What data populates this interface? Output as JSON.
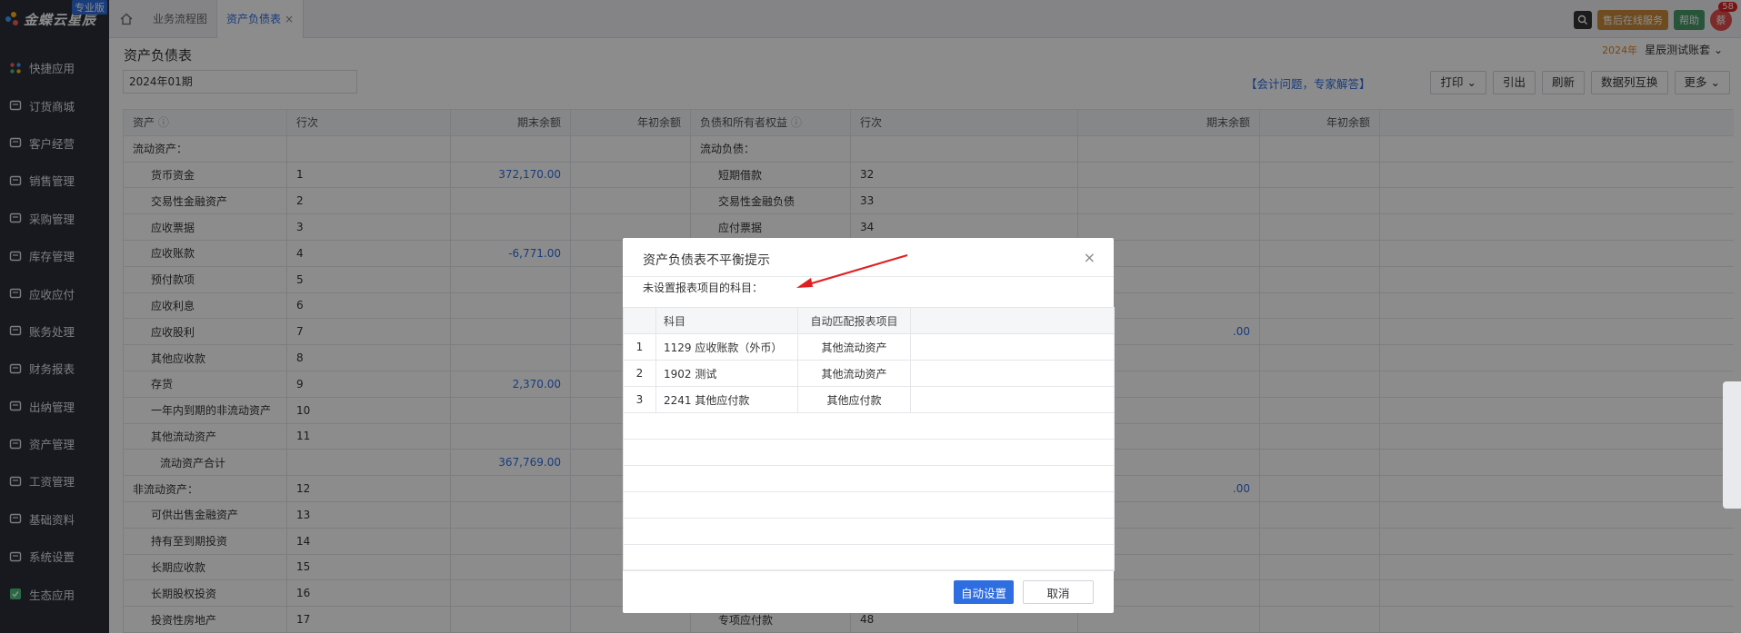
{
  "app": {
    "brand": "金蝶云星辰",
    "edition_badge": "专业版"
  },
  "sidebar": {
    "items": [
      {
        "label": "快捷应用",
        "icon": "grid-icon"
      },
      {
        "label": "订货商城",
        "icon": "shop-icon"
      },
      {
        "label": "客户经营",
        "icon": "user-icon"
      },
      {
        "label": "销售管理",
        "icon": "chart-icon"
      },
      {
        "label": "采购管理",
        "icon": "cart-icon"
      },
      {
        "label": "库存管理",
        "icon": "box-icon"
      },
      {
        "label": "应收应付",
        "icon": "money-icon"
      },
      {
        "label": "账务处理",
        "icon": "ledger-icon"
      },
      {
        "label": "财务报表",
        "icon": "report-icon"
      },
      {
        "label": "出纳管理",
        "icon": "cashier-icon"
      },
      {
        "label": "资产管理",
        "icon": "asset-icon"
      },
      {
        "label": "工资管理",
        "icon": "salary-icon"
      },
      {
        "label": "基础资料",
        "icon": "layers-icon"
      },
      {
        "label": "系统设置",
        "icon": "gear-icon"
      },
      {
        "label": "生态应用",
        "icon": "check-icon"
      }
    ]
  },
  "topbar": {
    "tabs": [
      {
        "label": "业务流程图"
      },
      {
        "label": "资产负债表",
        "close": "×"
      }
    ],
    "service_label": "售后在线服务",
    "help_label": "帮助",
    "avatar_text": "蔡",
    "notify_count": "58"
  },
  "page": {
    "title": "资产负债表",
    "period_value": "2024年01期",
    "meta_year": "2024年",
    "account_set": "星辰测试账套",
    "expert_link": "【会计问题，专家解答】",
    "toolbar": {
      "print": "打印",
      "export": "引出",
      "refresh": "刷新",
      "swap": "数据列互换",
      "more": "更多"
    }
  },
  "balance_sheet": {
    "headers": {
      "asset": "资产",
      "row": "行次",
      "end_bal": "期末余额",
      "begin_bal": "年初余额",
      "liab": "负债和所有者权益",
      "row2": "行次",
      "end_bal2": "期末余额",
      "begin_bal2": "年初余额"
    },
    "rows": [
      {
        "a": "流动资产：",
        "ar": "",
        "ae": "",
        "ab": "",
        "l": "流动负债：",
        "lr": "",
        "le": "",
        "lb": "",
        "ai": 0,
        "li": 0
      },
      {
        "a": "货币资金",
        "ar": "1",
        "ae": "372,170.00",
        "ab": "",
        "l": "短期借款",
        "lr": "32",
        "le": "",
        "lb": "",
        "ai": 1,
        "li": 1
      },
      {
        "a": "交易性金融资产",
        "ar": "2",
        "ae": "",
        "ab": "",
        "l": "交易性金融负债",
        "lr": "33",
        "le": "",
        "lb": "",
        "ai": 1,
        "li": 1
      },
      {
        "a": "应收票据",
        "ar": "3",
        "ae": "",
        "ab": "",
        "l": "应付票据",
        "lr": "34",
        "le": "",
        "lb": "",
        "ai": 1,
        "li": 1
      },
      {
        "a": "应收账款",
        "ar": "4",
        "ae": "-6,771.00",
        "ab": "",
        "l": "",
        "lr": "",
        "le": "",
        "lb": "",
        "ai": 1,
        "li": 1
      },
      {
        "a": "预付款项",
        "ar": "5",
        "ae": "",
        "ab": "",
        "l": "",
        "lr": "",
        "le": "",
        "lb": "",
        "ai": 1,
        "li": 1
      },
      {
        "a": "应收利息",
        "ar": "6",
        "ae": "",
        "ab": "",
        "l": "",
        "lr": "",
        "le": "",
        "lb": "",
        "ai": 1,
        "li": 1
      },
      {
        "a": "应收股利",
        "ar": "7",
        "ae": "",
        "ab": "",
        "l": "",
        "lr": "",
        "le": ".00",
        "lb": "",
        "ai": 1,
        "li": 1
      },
      {
        "a": "其他应收款",
        "ar": "8",
        "ae": "",
        "ab": "",
        "l": "",
        "lr": "",
        "le": "",
        "lb": "",
        "ai": 1,
        "li": 1
      },
      {
        "a": "存货",
        "ar": "9",
        "ae": "2,370.00",
        "ab": "",
        "l": "",
        "lr": "",
        "le": "",
        "lb": "",
        "ai": 1,
        "li": 1
      },
      {
        "a": "一年内到期的非流动资产",
        "ar": "10",
        "ae": "",
        "ab": "",
        "l": "",
        "lr": "",
        "le": "",
        "lb": "",
        "ai": 1,
        "li": 1
      },
      {
        "a": "其他流动资产",
        "ar": "11",
        "ae": "",
        "ab": "",
        "l": "",
        "lr": "",
        "le": "",
        "lb": "",
        "ai": 1,
        "li": 1
      },
      {
        "a": "流动资产合计",
        "ar": "",
        "ae": "367,769.00",
        "ab": "",
        "l": "",
        "lr": "",
        "le": "",
        "lb": "",
        "ai": 2,
        "li": 1
      },
      {
        "a": "非流动资产：",
        "ar": "12",
        "ae": "",
        "ab": "",
        "l": "",
        "lr": "",
        "le": ".00",
        "lb": "",
        "ai": 0,
        "li": 1
      },
      {
        "a": "可供出售金融资产",
        "ar": "13",
        "ae": "",
        "ab": "",
        "l": "",
        "lr": "",
        "le": "",
        "lb": "",
        "ai": 1,
        "li": 1
      },
      {
        "a": "持有至到期投资",
        "ar": "14",
        "ae": "",
        "ab": "",
        "l": "",
        "lr": "",
        "le": "",
        "lb": "",
        "ai": 1,
        "li": 1
      },
      {
        "a": "长期应收款",
        "ar": "15",
        "ae": "",
        "ab": "",
        "l": "",
        "lr": "",
        "le": "",
        "lb": "",
        "ai": 1,
        "li": 1
      },
      {
        "a": "长期股权投资",
        "ar": "16",
        "ae": "",
        "ab": "",
        "l": "",
        "lr": "",
        "le": "",
        "lb": "",
        "ai": 1,
        "li": 1
      },
      {
        "a": "投资性房地产",
        "ar": "17",
        "ae": "",
        "ab": "",
        "l": "专项应付款",
        "lr": "48",
        "le": "",
        "lb": "",
        "ai": 1,
        "li": 1
      }
    ]
  },
  "modal": {
    "title": "资产负债表不平衡提示",
    "close": "×",
    "subtitle": "未设置报表项目的科目：",
    "col_account": "科目",
    "col_auto": "自动匹配报表项目",
    "rows": [
      {
        "no": "1",
        "account": "1129 应收账款（外币）",
        "item": "其他流动资产"
      },
      {
        "no": "2",
        "account": "1902 测试",
        "item": "其他流动资产"
      },
      {
        "no": "3",
        "account": "2241 其他应付款",
        "item": "其他应付款"
      }
    ],
    "empty_rows": 6,
    "auto_btn": "自动设置",
    "cancel_btn": "取消"
  }
}
